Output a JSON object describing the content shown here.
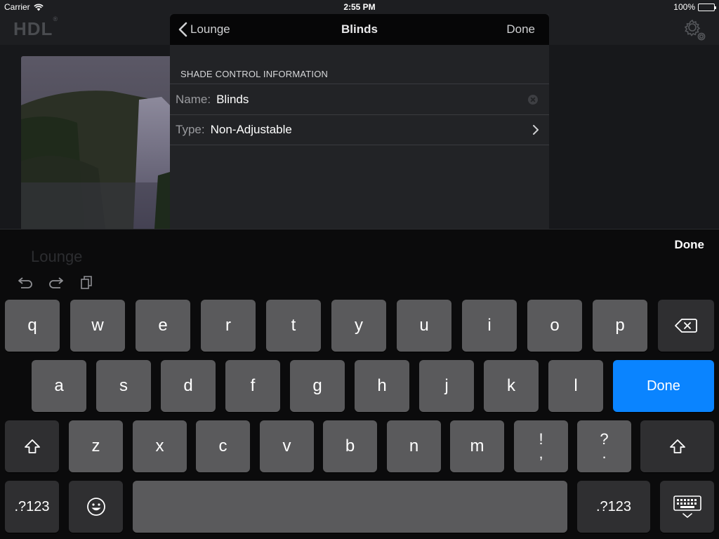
{
  "status_bar": {
    "carrier": "Carrier",
    "time": "2:55 PM",
    "battery": "100%"
  },
  "app": {
    "logo": "HDL",
    "room_name": "Lounge"
  },
  "popover": {
    "back_label": "Lounge",
    "title": "Blinds",
    "done_label": "Done",
    "section_header": "SHADE CONTROL INFORMATION",
    "name_label": "Name:",
    "name_value": "Blinds",
    "type_label": "Type:",
    "type_value": "Non-Adjustable"
  },
  "keyboard": {
    "done_label": "Done",
    "row1": [
      "q",
      "w",
      "e",
      "r",
      "t",
      "y",
      "u",
      "i",
      "o",
      "p"
    ],
    "row2": [
      "a",
      "s",
      "d",
      "f",
      "g",
      "h",
      "j",
      "k",
      "l"
    ],
    "row3": [
      "z",
      "x",
      "c",
      "v",
      "b",
      "n",
      "m"
    ],
    "punct1": {
      "top": "!",
      "bottom": ","
    },
    "punct2": {
      "top": "?",
      "bottom": "."
    },
    "return_label": "Done",
    "numbers_label": ".?123"
  },
  "colors": {
    "accent": "#0a84ff",
    "key": "#5a5a5c",
    "key_dark": "#2f2f31"
  }
}
